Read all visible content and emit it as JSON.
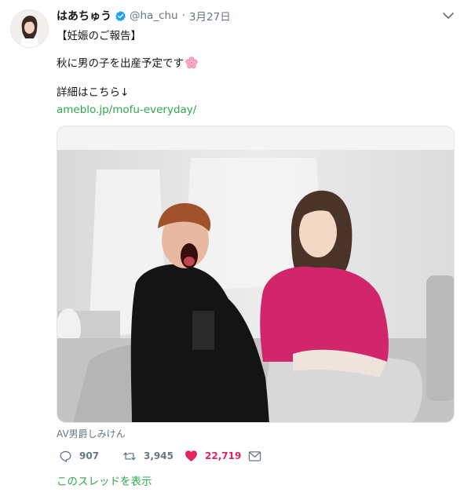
{
  "tweet": {
    "display_name": "はあちゅう",
    "handle": "@ha_chu",
    "separator": "·",
    "date": "3月27日",
    "lines": [
      "【妊娠のご報告】",
      "秋に男の子を出産予定です",
      "詳細はこちら↓",
      "ameblo.jp/mofu-everyday/"
    ],
    "emoji": "cherry-blossom-icon",
    "photo_credit": "AV男爵しみけん",
    "stats": {
      "replies": "907",
      "retweets": "3,945",
      "likes": "22,719"
    },
    "show_thread": "このスレッドを表示"
  },
  "colors": {
    "link": "#2ea84f",
    "like": "#e0245e",
    "muted": "#657786",
    "verified": "#1da1f2"
  }
}
